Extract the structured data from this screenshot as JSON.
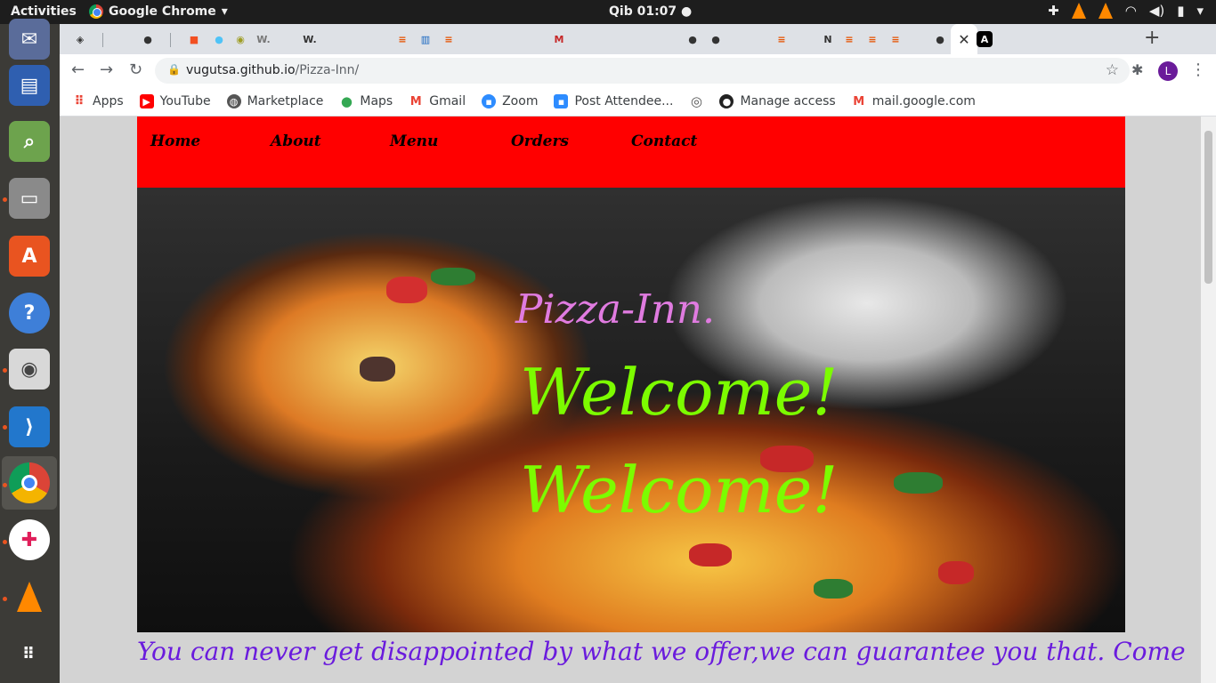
{
  "system": {
    "activities": "Activities",
    "app_name": "Google Chrome",
    "clock": "Qib 01:07"
  },
  "browser": {
    "url_host": "vugutsa.github.io",
    "url_path": "/Pizza-Inn/",
    "profile_initial": "L",
    "tab_labels": [
      "W.",
      "W.",
      "N"
    ],
    "bookmarks": [
      "Apps",
      "YouTube",
      "Marketplace",
      "Maps",
      "Gmail",
      "Zoom",
      "Post Attendee...",
      "Manage access",
      "mail.google.com"
    ]
  },
  "page": {
    "nav": [
      "Home",
      "About",
      "Menu",
      "Orders",
      "Contact"
    ],
    "brand": "Pizza-Inn.",
    "welcome_1": "Welcome!",
    "welcome_2": "Welcome!",
    "tagline": "You can never get disappointed by what we offer,we can guarantee you that. Come"
  },
  "colors": {
    "navbar_bg": "#ff0000",
    "brand": "#e07be0",
    "welcome": "#7cfc00",
    "tagline": "#6a1bdd"
  }
}
